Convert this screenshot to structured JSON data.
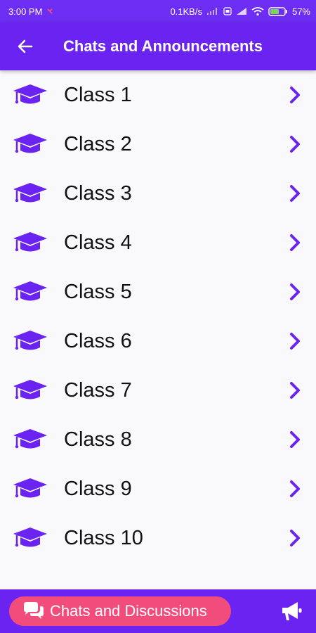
{
  "status_bar": {
    "time": "3:00 PM",
    "network_speed": "0.1KB/s",
    "battery": "57%"
  },
  "app_bar": {
    "title": "Chats and Announcements",
    "back_icon": "arrow-left-icon"
  },
  "classes": [
    {
      "label": "Class 1"
    },
    {
      "label": "Class 2"
    },
    {
      "label": "Class 3"
    },
    {
      "label": "Class 4"
    },
    {
      "label": "Class 5"
    },
    {
      "label": "Class 6"
    },
    {
      "label": "Class 7"
    },
    {
      "label": "Class 8"
    },
    {
      "label": "Class 9"
    },
    {
      "label": "Class 10"
    }
  ],
  "bottom_bar": {
    "chat_button_label": "Chats and Discussions",
    "chat_icon": "chat-bubbles-icon",
    "announce_icon": "megaphone-icon"
  },
  "colors": {
    "primary": "#6a23f0",
    "accent_pink": "#f24c7c",
    "icon_purple": "#6a23f0"
  }
}
